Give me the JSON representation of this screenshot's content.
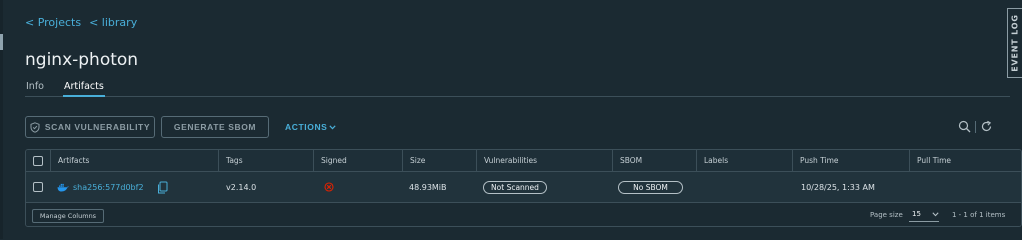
{
  "breadcrumb": {
    "projects": "< Projects",
    "library": "< library"
  },
  "page_title": "nginx-photon",
  "tabs": [
    {
      "label": "Info",
      "active": false
    },
    {
      "label": "Artifacts",
      "active": true
    }
  ],
  "event_log": "EVENT LOG",
  "toolbar": {
    "scan_vulnerability": "SCAN VULNERABILITY",
    "generate_sbom": "GENERATE SBOM",
    "actions": "ACTIONS",
    "icons": [
      "search-icon",
      "refresh-icon"
    ]
  },
  "table": {
    "columns": [
      "Artifacts",
      "Tags",
      "Signed",
      "Size",
      "Vulnerabilities",
      "SBOM",
      "Labels",
      "Push Time",
      "Pull Time"
    ],
    "rows": [
      {
        "artifact": "sha256:577d0bf2",
        "tags": "v2.14.0",
        "signed": "not-signed-icon",
        "size": "48.93MiB",
        "vulnerabilities": "Not Scanned",
        "sbom": "No SBOM",
        "labels": "",
        "push_time": "10/28/25, 1:33 AM",
        "pull_time": ""
      }
    ]
  },
  "footer": {
    "manage_columns": "Manage Columns",
    "page_size_label": "Page size",
    "page_size_value": "15",
    "items_count": "1 - 1 of 1 items"
  },
  "colors": {
    "background": "#1b2a32",
    "accent": "#49afd9",
    "danger": "#e12200",
    "docker_blue": "#2496ed"
  }
}
